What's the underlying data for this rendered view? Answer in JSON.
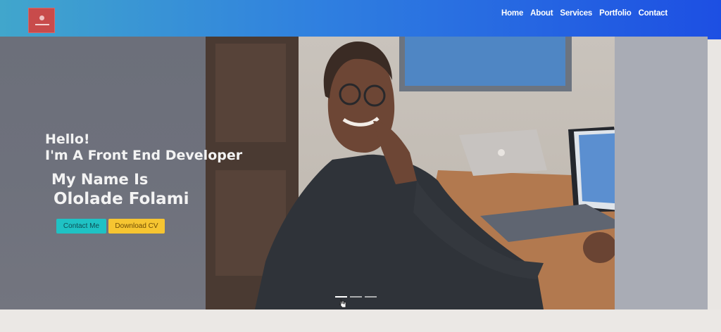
{
  "nav": {
    "items": [
      "Home",
      "About",
      "Services",
      "Portfolio",
      "Contact"
    ]
  },
  "hero": {
    "greeting": "Hello!",
    "role": "I'm A Front End Developer",
    "name_intro": "My Name Is",
    "name": "Ololade Folami",
    "buttons": {
      "contact": "Contact Me",
      "download": "Download CV"
    },
    "carousel": {
      "slides": 3,
      "active": 0
    }
  },
  "colors": {
    "navbar_gradient": [
      "#41a6cc",
      "#1d4fe3"
    ],
    "contact_button": "#1fc2c4",
    "download_button": "#f6c531"
  },
  "icons": [
    "logo-icon",
    "pointer-cursor-icon"
  ]
}
